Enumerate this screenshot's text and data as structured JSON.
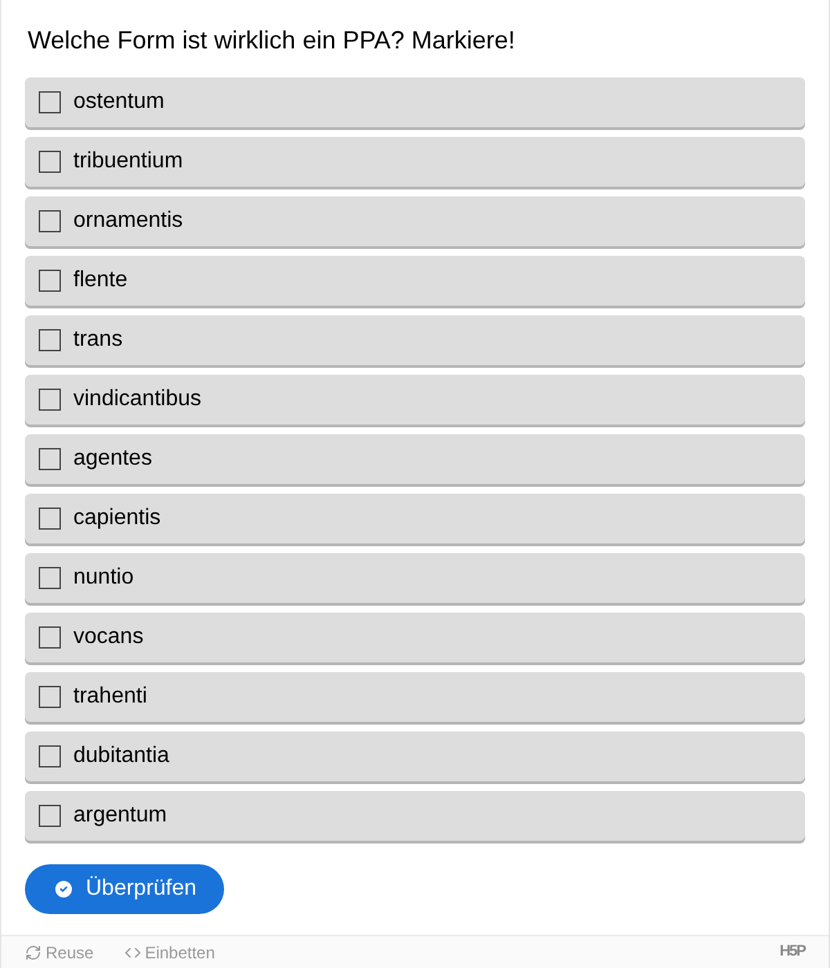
{
  "question": "Welche Form ist wirklich ein PPA? Markiere!",
  "answers": [
    {
      "label": "ostentum",
      "checked": false
    },
    {
      "label": "tribuentium",
      "checked": false
    },
    {
      "label": "ornamentis",
      "checked": false
    },
    {
      "label": "flente",
      "checked": false
    },
    {
      "label": "trans",
      "checked": false
    },
    {
      "label": "vindicantibus",
      "checked": false
    },
    {
      "label": "agentes",
      "checked": false
    },
    {
      "label": "capientis",
      "checked": false
    },
    {
      "label": "nuntio",
      "checked": false
    },
    {
      "label": "vocans",
      "checked": false
    },
    {
      "label": "trahenti",
      "checked": false
    },
    {
      "label": "dubitantia",
      "checked": false
    },
    {
      "label": "argentum",
      "checked": false
    }
  ],
  "check_button": "Überprüfen",
  "footer": {
    "reuse": "Reuse",
    "embed": "Einbetten",
    "logo": "H5P"
  }
}
